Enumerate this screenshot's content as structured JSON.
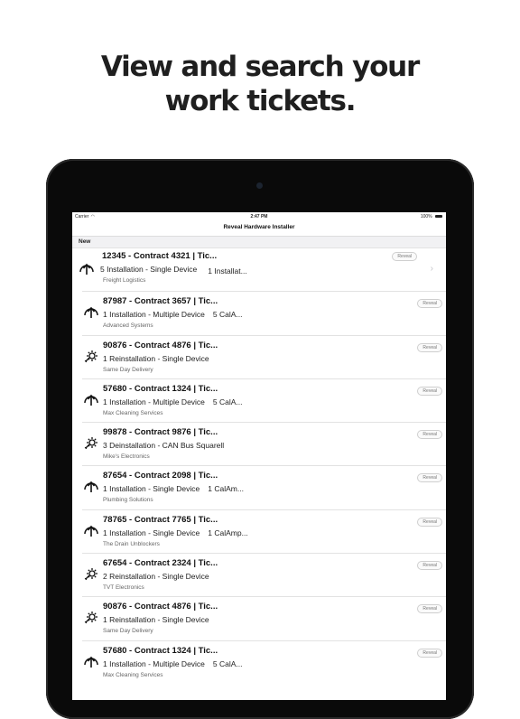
{
  "headline": {
    "line1": "View and search your",
    "line2": "work tickets."
  },
  "statusbar": {
    "carrier": "Carrier",
    "time": "2:47 PM",
    "battery": "100%"
  },
  "app": {
    "title": "Reveal Hardware Installer"
  },
  "section": {
    "label": "New"
  },
  "reveal_label": "Reveal",
  "tickets": [
    {
      "icon": "arrow-up-icon",
      "title": "12345 - Contract 4321 | Tic...",
      "line": "5 Installation - Single Device",
      "extra": "1 Installat...",
      "company": "Freight Logistics"
    },
    {
      "icon": "arrow-up-icon",
      "title": "87987 - Contract 3657 | Tic...",
      "line": "1 Installation - Multiple Device",
      "extra": "5 CalA...",
      "company": "Advanced Systems"
    },
    {
      "icon": "gear-icon",
      "title": "90876 - Contract 4876 | Tic...",
      "line": "1 Reinstallation - Single Device",
      "extra": "",
      "company": "Same Day Delivery"
    },
    {
      "icon": "arrow-up-icon",
      "title": "57680 - Contract 1324 | Tic...",
      "line": "1 Installation - Multiple Device",
      "extra": "5 CalA...",
      "company": "Max Cleaning Services"
    },
    {
      "icon": "gear-icon",
      "title": "99878 - Contract 9876 | Tic...",
      "line": "3 Deinstallation - CAN Bus Squarell",
      "extra": "",
      "company": "Mike's Electronics"
    },
    {
      "icon": "arrow-up-icon",
      "title": "87654 - Contract 2098 | Tic...",
      "line": "1 Installation - Single Device",
      "extra": "1 CalAm...",
      "company": "Plumbing Solutions"
    },
    {
      "icon": "arrow-up-icon",
      "title": "78765 - Contract 7765 | Tic...",
      "line": "1 Installation - Single Device",
      "extra": "1 CalAmp...",
      "company": "The Drain Unblockers"
    },
    {
      "icon": "gear-icon",
      "title": "67654 - Contract 2324 | Tic...",
      "line": "2 Reinstallation - Single Device",
      "extra": "",
      "company": "TVT Electronics"
    },
    {
      "icon": "gear-icon",
      "title": "90876 - Contract 4876 | Tic...",
      "line": "1 Reinstallation - Single Device",
      "extra": "",
      "company": "Same Day Delivery"
    },
    {
      "icon": "arrow-up-icon",
      "title": "57680 - Contract 1324 | Tic...",
      "line": "1 Installation - Multiple Device",
      "extra": "5 CalA...",
      "company": "Max Cleaning Services"
    }
  ]
}
